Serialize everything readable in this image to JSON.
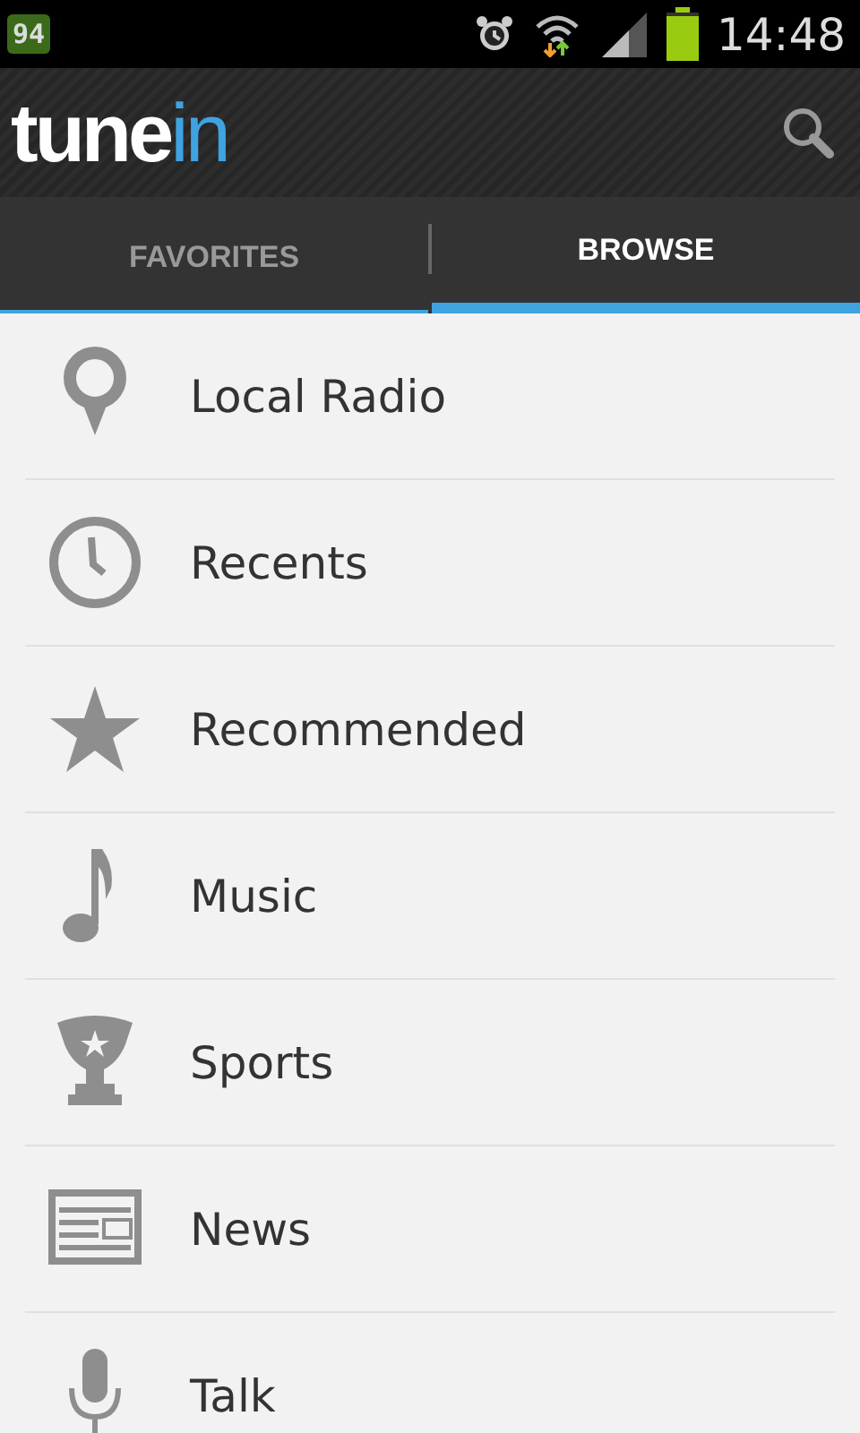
{
  "status_bar": {
    "badge": "94",
    "time": "14:48"
  },
  "action_bar": {
    "logo": {
      "main": "tune",
      "accent": "in"
    }
  },
  "tabs": [
    {
      "label": "FAVORITES",
      "selected": false
    },
    {
      "label": "BROWSE",
      "selected": true
    }
  ],
  "items": [
    {
      "label": "Local Radio"
    },
    {
      "label": "Recents"
    },
    {
      "label": "Recommended"
    },
    {
      "label": "Music"
    },
    {
      "label": "Sports"
    },
    {
      "label": "News"
    },
    {
      "label": "Talk"
    }
  ]
}
